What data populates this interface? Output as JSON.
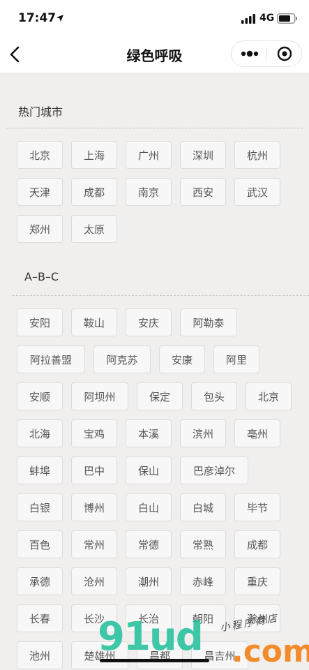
{
  "status_bar": {
    "time": "17:47",
    "network": "4G",
    "icons": [
      "location-arrow-icon",
      "signal-bars-icon",
      "battery-icon"
    ]
  },
  "nav_bar": {
    "title": "绿色呼吸",
    "icons": [
      "back-arrow-icon",
      "more-dots-icon",
      "close-circle-icon"
    ]
  },
  "sections": {
    "hot": {
      "title": "热门城市",
      "rows": [
        [
          "北京",
          "上海",
          "广州",
          "深圳",
          "杭州"
        ],
        [
          "天津",
          "成都",
          "南京",
          "西安",
          "武汉"
        ],
        [
          "郑州",
          "太原"
        ]
      ]
    },
    "abc": {
      "title": "A–B–C",
      "rows": [
        [
          "安阳",
          "鞍山",
          "安庆",
          "阿勒泰"
        ],
        [
          "阿拉善盟",
          "阿克苏",
          "安康",
          "阿里"
        ],
        [
          "安顺",
          "阿坝州",
          "保定",
          "包头",
          "北京"
        ],
        [
          "北海",
          "宝鸡",
          "本溪",
          "滨州",
          "亳州"
        ],
        [
          "蚌埠",
          "巴中",
          "保山",
          "巴彦淖尔"
        ],
        [
          "白银",
          "博州",
          "白山",
          "白城",
          "毕节"
        ],
        [
          "百色",
          "常州",
          "常德",
          "常熟",
          "成都"
        ],
        [
          "承德",
          "沧州",
          "潮州",
          "赤峰",
          "重庆"
        ],
        [
          "长春",
          "长沙",
          "长治",
          "朝阳",
          "滁州"
        ],
        [
          "池州",
          "楚雄州",
          "昌都",
          "昌吉州"
        ]
      ]
    }
  },
  "watermark": {
    "letters": "91ud",
    "suffix": ".com",
    "caption": "小程序商店"
  },
  "colors": {
    "background": "#f1efee",
    "chip_bg": "#f7f7f7",
    "chip_border": "#dcdcdc",
    "watermark_green": "#2ec4a0",
    "watermark_orange": "#f28b2a"
  }
}
